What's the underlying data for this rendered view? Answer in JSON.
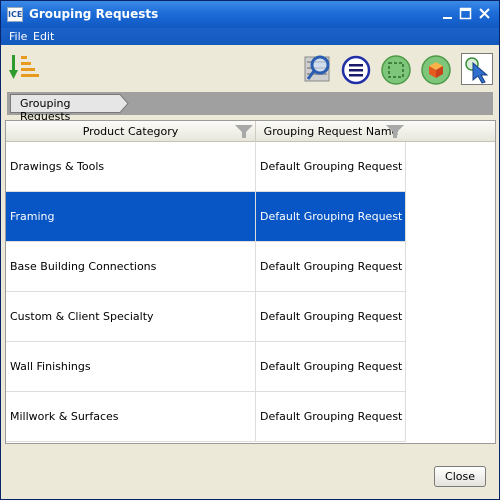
{
  "window": {
    "title": "Grouping Requests",
    "app_icon_text": "ICE",
    "colors": {
      "titlebar": "#1c6cd8",
      "selection": "#0856c6",
      "breadcrumb_bar": "#a0a0a0"
    }
  },
  "menu": {
    "items": [
      {
        "label": "File"
      },
      {
        "label": "Edit"
      }
    ]
  },
  "toolbar": {
    "icons": [
      "sort-list-icon",
      "search-filter-icon",
      "menu-lines-icon",
      "selection-frame-icon",
      "cube-icon",
      "pointer-select-icon"
    ]
  },
  "breadcrumb": {
    "items": [
      {
        "label": "Grouping Requests"
      }
    ]
  },
  "table": {
    "columns": [
      {
        "label": "Product Category"
      },
      {
        "label": "Grouping Request Name"
      }
    ],
    "selected_row": 1,
    "rows": [
      {
        "category": "Drawings & Tools",
        "name": "Default Grouping Request"
      },
      {
        "category": "Framing",
        "name": "Default Grouping Request"
      },
      {
        "category": "Base Building Connections",
        "name": "Default Grouping Request"
      },
      {
        "category": "Custom & Client Specialty",
        "name": "Default Grouping Request"
      },
      {
        "category": "Wall Finishings",
        "name": "Default Grouping Request"
      },
      {
        "category": "Millwork & Surfaces",
        "name": "Default Grouping Request"
      }
    ]
  },
  "footer": {
    "close_label": "Close"
  }
}
